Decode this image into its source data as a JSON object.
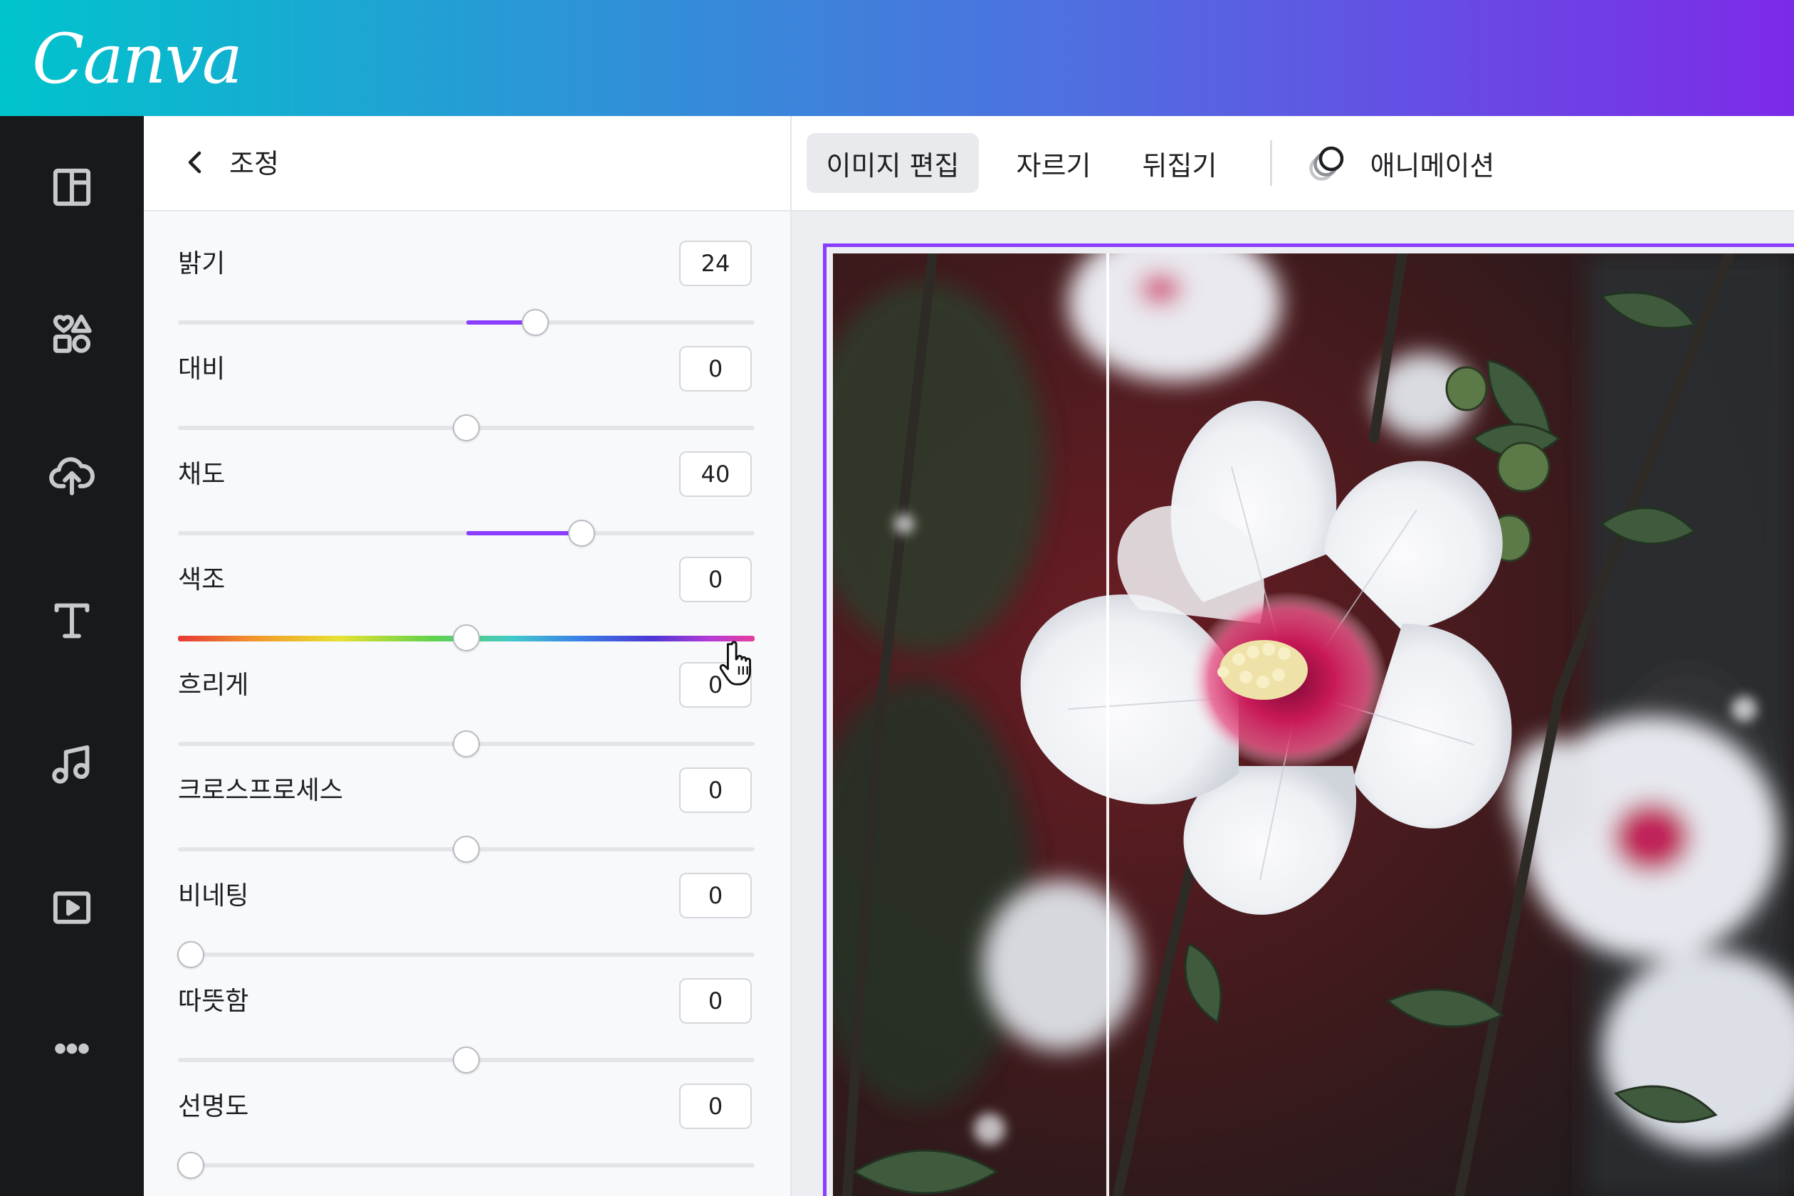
{
  "app": {
    "logo": "Canva"
  },
  "rail": {
    "items": [
      {
        "icon": "layout-icon"
      },
      {
        "icon": "elements-icon"
      },
      {
        "icon": "upload-icon"
      },
      {
        "icon": "text-icon"
      },
      {
        "icon": "music-icon"
      },
      {
        "icon": "video-icon"
      },
      {
        "icon": "more-icon"
      }
    ]
  },
  "panel": {
    "title": "조정",
    "adjustments": [
      {
        "label": "밝기",
        "value": "24",
        "level": 0.62,
        "fill_from": 0.5
      },
      {
        "label": "대비",
        "value": "0",
        "level": 0.5
      },
      {
        "label": "채도",
        "value": "40",
        "level": 0.7,
        "fill_from": 0.5
      },
      {
        "label": "색조",
        "value": "0",
        "level": 0.5,
        "track": "hue"
      },
      {
        "label": "흐리게",
        "value": "0",
        "level": 0.5
      },
      {
        "label": "크로스프로세스",
        "value": "0",
        "level": 0.5
      },
      {
        "label": "비네팅",
        "value": "0",
        "level": 0.0
      },
      {
        "label": "따뜻함",
        "value": "0",
        "level": 0.5
      },
      {
        "label": "선명도",
        "value": "0",
        "level": 0.0
      }
    ]
  },
  "toolbar": {
    "edit_image": "이미지 편집",
    "crop": "자르기",
    "flip": "뒤집기",
    "animate": "애니메이션"
  },
  "colors": {
    "accent": "#8b3dff",
    "rail_bg": "#18191b"
  }
}
